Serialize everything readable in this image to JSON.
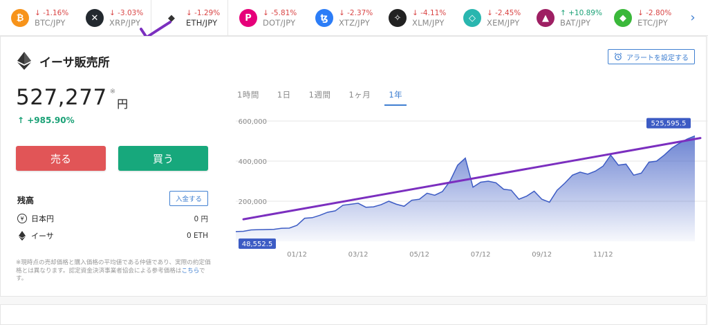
{
  "tickers": [
    {
      "symbol": "₿",
      "color": "#f7931a",
      "change": "↓ -1.16%",
      "dir": "down",
      "pair": "BTC/JPY"
    },
    {
      "symbol": "✕",
      "color": "#23292f",
      "change": "↓ -3.03%",
      "dir": "down",
      "pair": "XRP/JPY"
    },
    {
      "symbol": "◆",
      "color": "#ffffff",
      "change": "↓ -1.29%",
      "dir": "down",
      "pair": "ETH/JPY"
    },
    {
      "symbol": "P",
      "color": "#e6007a",
      "change": "↓ -5.81%",
      "dir": "down",
      "pair": "DOT/JPY"
    },
    {
      "symbol": "ꜩ",
      "color": "#2c7df7",
      "change": "↓ -2.37%",
      "dir": "down",
      "pair": "XTZ/JPY"
    },
    {
      "symbol": "✧",
      "color": "#222222",
      "change": "↓ -4.11%",
      "dir": "down",
      "pair": "XLM/JPY"
    },
    {
      "symbol": "◇",
      "color": "#29b6af",
      "change": "↓ -2.45%",
      "dir": "down",
      "pair": "XEM/JPY"
    },
    {
      "symbol": "▲",
      "color": "#9e1f63",
      "change": "↑ +10.89%",
      "dir": "up",
      "pair": "BAT/JPY"
    },
    {
      "symbol": "◆",
      "color": "#3ab83a",
      "change": "↓ -2.80%",
      "dir": "down",
      "pair": "ETC/JPY"
    }
  ],
  "header": {
    "title": "イーサ販売所",
    "alert_label": "アラートを設定する"
  },
  "price": {
    "value": "527,277",
    "mark": "※",
    "unit": "円",
    "change": "↑ +985.90%"
  },
  "actions": {
    "sell": "売る",
    "buy": "買う"
  },
  "balance": {
    "title": "残高",
    "deposit_label": "入金する",
    "rows": [
      {
        "label": "日本円",
        "value": "0 円"
      },
      {
        "label": "イーサ",
        "value": "0 ETH"
      }
    ]
  },
  "note": {
    "text": "※現時点の売却価格と購入価格の平均値である仲値であり、実際の約定価格とは異なります。認定資金決済事業者協会による参考価格は",
    "link": "こちら",
    "tail": "です。"
  },
  "tabs": [
    "1時間",
    "1日",
    "1週間",
    "1ヶ月",
    "1年"
  ],
  "active_tab": "1年",
  "colors": {
    "accent": "#3f7fd1",
    "sell": "#e15557",
    "buy": "#17a87c",
    "area": "#3c5bc4",
    "trend": "#7b2fbf"
  },
  "chart_data": {
    "type": "area",
    "ylim": [
      0,
      600000
    ],
    "yticks": [
      "600,000",
      "400,000",
      "200,000"
    ],
    "yticks_values": [
      600000,
      400000,
      200000
    ],
    "xticks": [
      "01/12",
      "03/12",
      "05/12",
      "07/12",
      "09/12",
      "11/12"
    ],
    "xticks_pos": [
      8,
      16,
      24,
      32,
      40,
      48
    ],
    "max_label": "525,595.5",
    "min_label": "48,552.5",
    "values": [
      48552,
      50000,
      57000,
      58000,
      59000,
      60000,
      65000,
      66000,
      80000,
      115000,
      118000,
      130000,
      145000,
      152000,
      180000,
      185000,
      190000,
      170000,
      172000,
      183000,
      200000,
      185000,
      175000,
      205000,
      210000,
      240000,
      230000,
      248000,
      300000,
      380000,
      415000,
      270000,
      295000,
      300000,
      292000,
      260000,
      255000,
      210000,
      225000,
      250000,
      210000,
      195000,
      255000,
      290000,
      330000,
      345000,
      335000,
      350000,
      375000,
      430000,
      380000,
      385000,
      330000,
      340000,
      395000,
      400000,
      430000,
      465000,
      490000,
      510000,
      525595
    ],
    "trendline": [
      110000,
      515000
    ]
  }
}
